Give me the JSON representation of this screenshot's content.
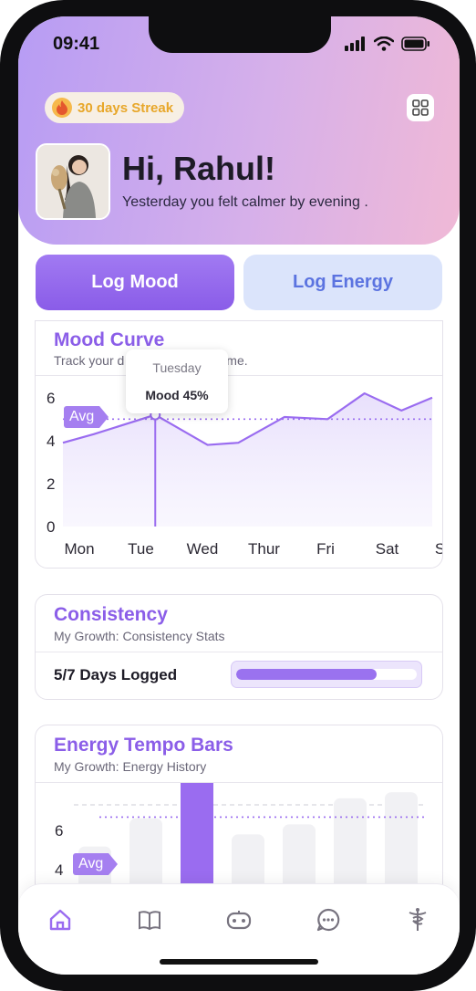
{
  "status_bar": {
    "time": "09:41"
  },
  "header": {
    "streak_label": "30 days Streak",
    "greeting": "Hi, Rahul!",
    "subtitle": "Yesterday you felt calmer by evening ."
  },
  "actions": {
    "log_mood": "Log Mood",
    "log_energy": "Log Energy"
  },
  "mood_curve": {
    "title": "Mood Curve",
    "subtitle": "Track your d",
    "subtitle_tail": "me.",
    "tooltip": {
      "day": "Tuesday",
      "value": "Mood 45%"
    },
    "avg_label": "Avg"
  },
  "consistency": {
    "title": "Consistency",
    "subtitle": "My Growth: Consistency Stats",
    "days_logged": "5/7 Days Logged",
    "progress": 0.78
  },
  "energy": {
    "title": "Energy Tempo Bars",
    "subtitle": "My Growth: Energy History",
    "avg_label": "Avg"
  },
  "nav": [
    "home-icon",
    "journal-icon",
    "game-icon",
    "chat-icon",
    "health-icon"
  ],
  "colors": {
    "accent": "#9a6cf0",
    "accent_light": "#dbe4fb",
    "streak": "#e8a72a"
  },
  "chart_data": [
    {
      "type": "line",
      "categories": [
        "Mon",
        "Tue",
        "Wed",
        "Thur",
        "Fri",
        "Sat",
        "Sun"
      ],
      "yticks": [
        "6",
        "4",
        "2",
        "0"
      ],
      "ylim": [
        0,
        6.5
      ],
      "x": [
        0,
        0.5,
        1.5,
        2.35,
        2.85,
        3.6,
        4.3,
        4.9,
        5.5,
        6
      ],
      "values": [
        3.9,
        4.3,
        5.2,
        3.8,
        3.9,
        5.1,
        5.0,
        6.2,
        5.4,
        6.0
      ],
      "highlight_index": 2,
      "avg": 5.0
    },
    {
      "type": "bar",
      "yticks": [
        "6",
        "4"
      ],
      "values": [
        3.2,
        4.6,
        8.2,
        3.8,
        4.3,
        5.6,
        5.9
      ],
      "highlight_index": 2,
      "avg": 4.3
    }
  ]
}
